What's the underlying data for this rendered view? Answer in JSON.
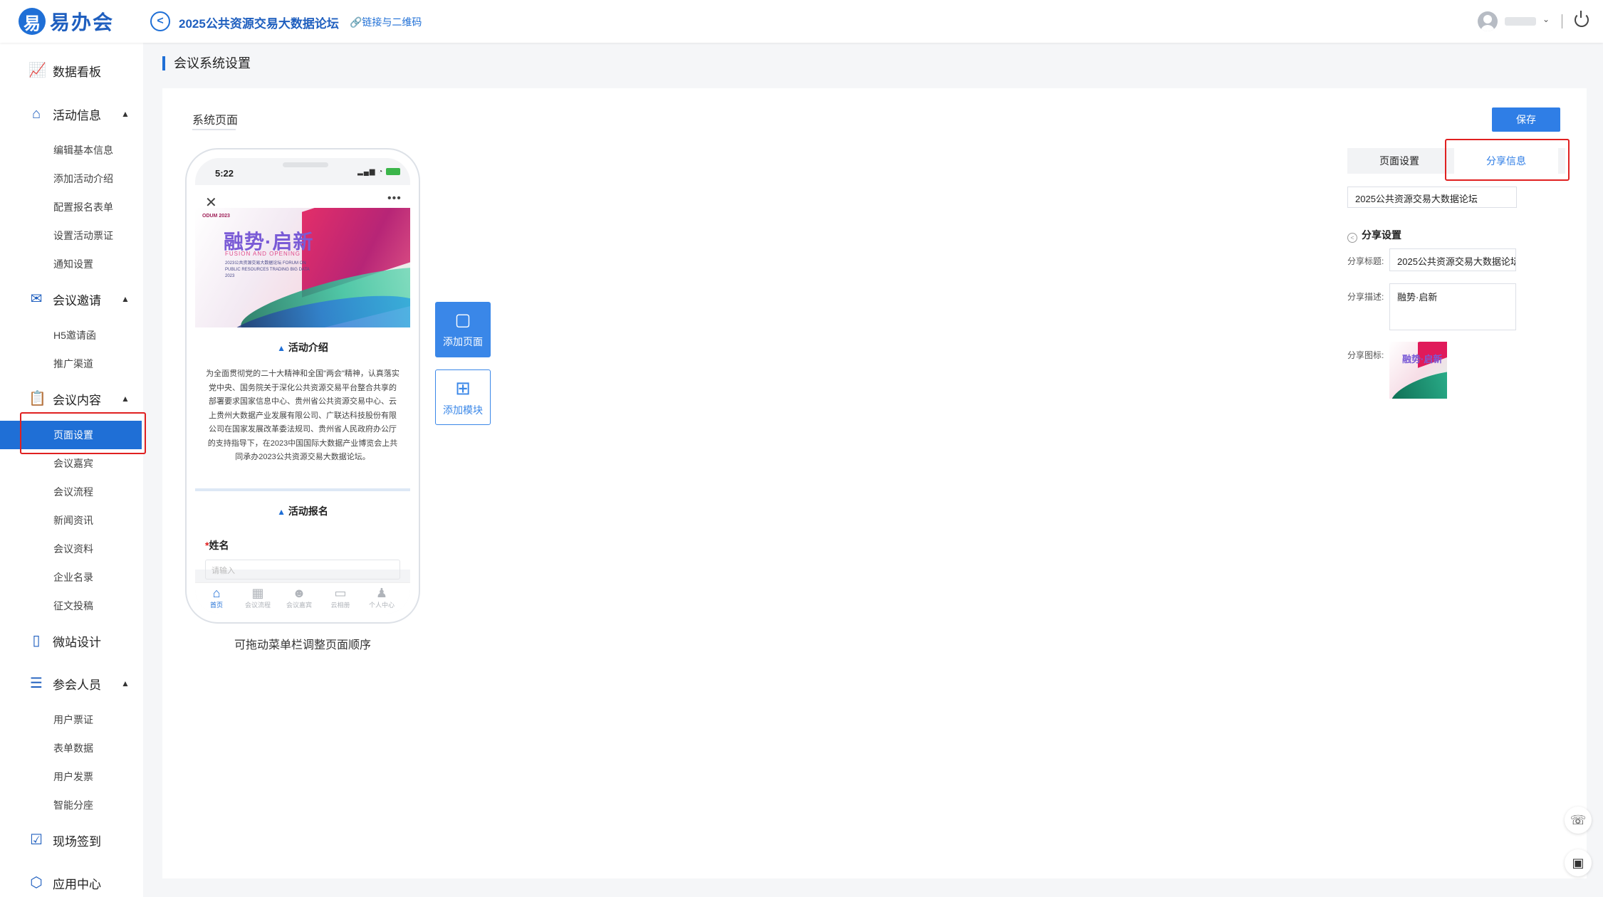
{
  "header": {
    "logo_mark": "易",
    "logo_text": "易办会",
    "back_glyph": "<",
    "event_title": "2025公共资源交易大数据论坛",
    "qr_link": "🔗链接与二维码",
    "user_caret": "⌄"
  },
  "sidebar": {
    "groups": [
      {
        "label": "数据看板",
        "icon": "chart-icon"
      },
      {
        "label": "活动信息",
        "icon": "home-icon",
        "expanded": true,
        "items": [
          "编辑基本信息",
          "添加活动介绍",
          "配置报名表单",
          "设置活动票证",
          "通知设置"
        ]
      },
      {
        "label": "会议邀请",
        "icon": "mail-icon",
        "expanded": true,
        "items": [
          "H5邀请函",
          "推广渠道"
        ]
      },
      {
        "label": "会议内容",
        "icon": "clipboard-icon",
        "expanded": true,
        "items": [
          "页面设置",
          "会议嘉宾",
          "会议流程",
          "新闻资讯",
          "会议资料",
          "企业名录",
          "征文投稿"
        ]
      },
      {
        "label": "微站设计",
        "icon": "phone-icon"
      },
      {
        "label": "参会人员",
        "icon": "list-icon",
        "expanded": true,
        "items": [
          "用户票证",
          "表单数据",
          "用户发票",
          "智能分座"
        ]
      },
      {
        "label": "现场签到",
        "icon": "calendar-check-icon"
      },
      {
        "label": "应用中心",
        "icon": "cube-icon"
      }
    ],
    "active_item": "页面设置",
    "caret_glyph": "▲"
  },
  "main": {
    "page_heading": "会议系统设置",
    "tab_label": "系统页面",
    "drag_hint": "可拖动菜单栏调整页面顺序",
    "add_page_label": "添加页面",
    "add_module_label": "添加模块"
  },
  "phone": {
    "time": "5:22",
    "status_icons": "▂▄▆ ◔",
    "close_glyph": "✕",
    "more_glyph": "•••",
    "banner": {
      "logo": "ODUM 2023",
      "title": "融势·启新",
      "subtitle": "FUSION AND OPENING",
      "lines": "2023公共资源交易大数据论坛 FORUM ON PUBLIC RESOURCES TRADING BIG DATA 2023"
    },
    "intro_title": "活动介绍",
    "intro_text": "为全面贯彻党的二十大精神和全国\"两会\"精神，认真落实党中央、国务院关于深化公共资源交易平台整合共享的部署要求国家信息中心、贵州省公共资源交易中心、云上贵州大数据产业发展有限公司、广联达科技股份有限公司在国家发展改革委法规司、贵州省人民政府办公厅的支持指导下，在2023中国国际大数据产业博览会上共同承办2023公共资源交易大数据论坛。",
    "signup_title": "活动报名",
    "field_name_label": "姓名",
    "field_required_mark": "*",
    "field_placeholder": "请输入",
    "drop_glyph": "▲",
    "tabbar": [
      {
        "label": "首页",
        "icon": "home-icon",
        "glyph": "⌂",
        "active": true
      },
      {
        "label": "会议流程",
        "icon": "calendar-icon",
        "glyph": "▦",
        "active": false
      },
      {
        "label": "会议嘉宾",
        "icon": "people-icon",
        "glyph": "☻",
        "active": false
      },
      {
        "label": "云相册",
        "icon": "folder-icon",
        "glyph": "▭",
        "active": false
      },
      {
        "label": "个人中心",
        "icon": "user-icon",
        "glyph": "♟",
        "active": false
      }
    ]
  },
  "settings": {
    "save_label": "保存",
    "tab_page": "页面设置",
    "tab_share": "分享信息",
    "page_title_value": "2025公共资源交易大数据论坛",
    "share_section": "分享设置",
    "share_section_glyph": "<",
    "share_title_label": "分享标题:",
    "share_title_value": "2025公共资源交易大数据论坛",
    "share_desc_label": "分享描述:",
    "share_desc_value": "融势·启新",
    "share_icon_label": "分享图标:",
    "thumb_title": "融势·启新"
  },
  "float_tools": {
    "support_glyph": "☏",
    "qr_glyph": "▣"
  },
  "colors": {
    "primary": "#1f6fd6",
    "highlight": "#e02020"
  }
}
